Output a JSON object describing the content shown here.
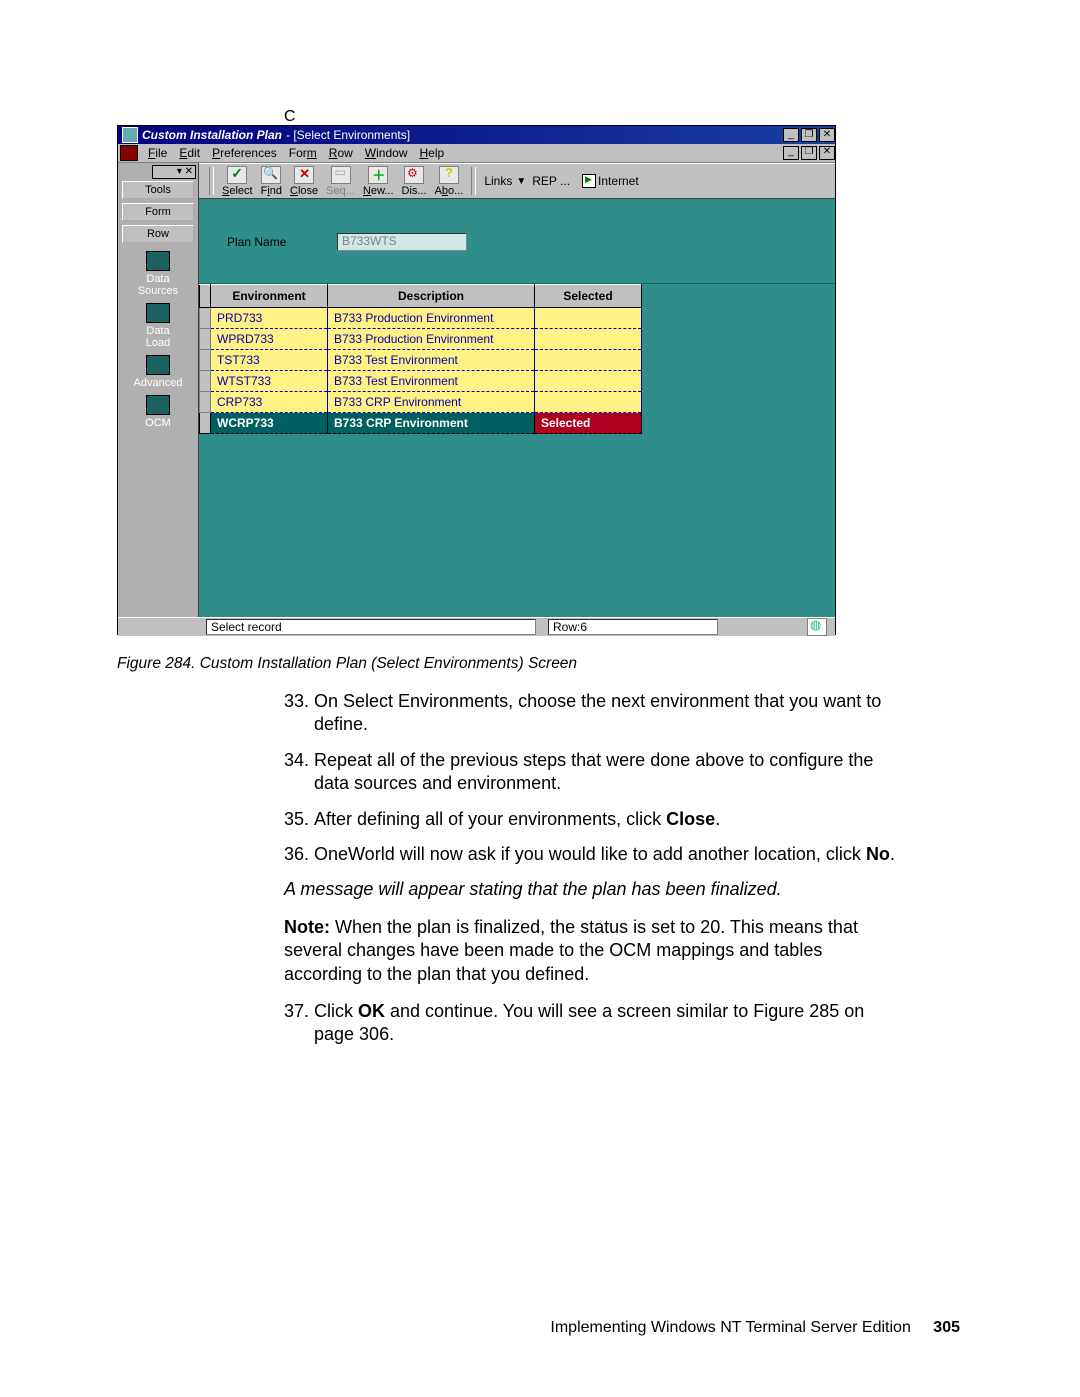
{
  "appendix_letter": "C",
  "window": {
    "title": "Custom Installation Plan",
    "subtitle": " - [Select Environments]",
    "menu": [
      "File",
      "Edit",
      "Preferences",
      "Form",
      "Row",
      "Window",
      "Help"
    ],
    "window_controls": {
      "min": "_",
      "max": "❐",
      "close": "✕"
    },
    "mdi_controls": {
      "min": "_",
      "max": "❐",
      "close": "✕"
    }
  },
  "sidebar": {
    "buttons": [
      "Tools",
      "Form",
      "Row"
    ],
    "items": [
      "Data\nSources",
      "Data\nLoad",
      "Advanced",
      "OCM"
    ]
  },
  "toolbar": {
    "select": "Select",
    "find": "Find",
    "close": "Close",
    "seq": "Seq...",
    "new": "New...",
    "dis": "Dis...",
    "abo": "Abo...",
    "links_label": "Links",
    "rep_label": "REP ...",
    "internet_label": "Internet"
  },
  "form": {
    "plan_name_label": "Plan Name",
    "plan_name_value": "B733WTS"
  },
  "grid": {
    "headers": {
      "env": "Environment",
      "desc": "Description",
      "sel": "Selected"
    },
    "rows": [
      {
        "env": "PRD733",
        "desc": "B733 Production Environment",
        "sel": ""
      },
      {
        "env": "WPRD733",
        "desc": "B733 Production Environment",
        "sel": ""
      },
      {
        "env": "TST733",
        "desc": "B733 Test Environment",
        "sel": ""
      },
      {
        "env": "WTST733",
        "desc": "B733 Test Environment",
        "sel": ""
      },
      {
        "env": "CRP733",
        "desc": "B733 CRP Environment",
        "sel": ""
      },
      {
        "env": "WCRP733",
        "desc": "B733 CRP Environment",
        "sel": "Selected",
        "selected": true
      }
    ]
  },
  "statusbar": {
    "msg": "Select record",
    "row": "Row:6"
  },
  "figure_caption": "Figure 284.  Custom Installation Plan (Select Environments) Screen",
  "steps": {
    "s33": {
      "n": "33.",
      "t": "On Select Environments, choose the next environment that you want to define."
    },
    "s34": {
      "n": "34.",
      "t": "Repeat all of the previous steps that were done above to configure the data sources and environment."
    },
    "s35": {
      "n": "35.",
      "t1": "After defining all of your environments, click ",
      "b": "Close",
      "t2": "."
    },
    "s36": {
      "n": "36.",
      "t1": "OneWorld will now ask if you would like to add another location, click ",
      "b": "No",
      "t2": "."
    },
    "s37": {
      "n": "37.",
      "t1": "Click ",
      "b": "OK",
      "t2": " and continue. You will see a screen similar to Figure 285 on page 306."
    }
  },
  "italic_line": "A message will appear stating that the plan has been finalized.",
  "note": {
    "label": "Note:",
    "body": " When the plan is finalized, the status is set to 20. This means that several changes have been made to the OCM mappings and tables according to the plan that you defined."
  },
  "footer": {
    "book": "Implementing Windows NT Terminal Server Edition",
    "page": "305"
  }
}
